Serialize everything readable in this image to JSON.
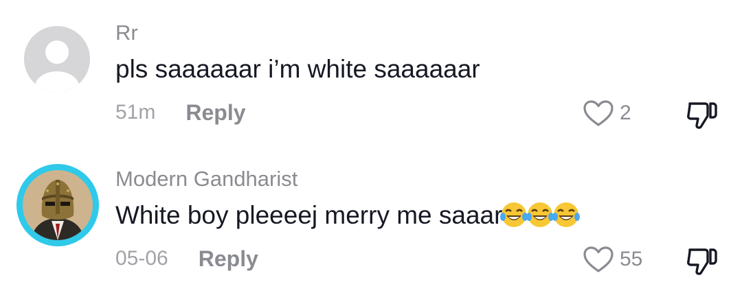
{
  "comments": [
    {
      "username": "Rr",
      "text": "pls saaaaaar i’m white saaaaaar",
      "time": "51m",
      "reply_label": "Reply",
      "like_count": "2",
      "avatar": "default-avatar-icon"
    },
    {
      "username": "Modern Gandharist",
      "text": "White boy pleeeej merry me saaar",
      "emojis": [
        "😂",
        "😂",
        "😂"
      ],
      "time": "05-06",
      "reply_label": "Reply",
      "like_count": "55",
      "avatar": "helmeted-warrior-avatar",
      "avatar_ring_color": "#2fc9ea"
    }
  ]
}
